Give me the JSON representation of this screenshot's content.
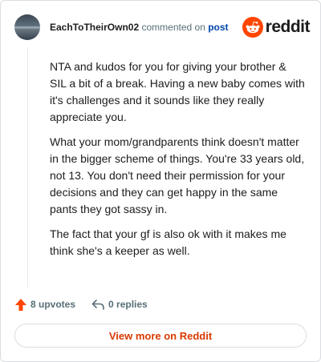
{
  "header": {
    "username": "EachToTheirOwn02",
    "action_text": "commented on",
    "post_link": "post",
    "brand": "reddit"
  },
  "comment": {
    "paragraphs": [
      "NTA and kudos for you for giving your brother & SIL a bit of a break. Having a new baby comes with it's challenges and it sounds like they really appreciate you.",
      "What your mom/grandparents think doesn't matter in the bigger scheme of things. You're 33 years old, not 13. You don't need their permission for your decisions and they can get happy in the same pants they got sassy in.",
      "The fact that your gf is also ok with it makes me think she's a keeper as well."
    ]
  },
  "stats": {
    "upvotes": "8 upvotes",
    "replies": "0 replies"
  },
  "footer": {
    "view_more": "View more on Reddit"
  },
  "colors": {
    "brand": "#ff4500",
    "link": "#0045ac",
    "view_more": "#d93a00"
  },
  "icons": {
    "upvote": "upvote-arrow-icon",
    "reply": "reply-arrow-icon",
    "logo": "reddit-snoo-icon"
  }
}
